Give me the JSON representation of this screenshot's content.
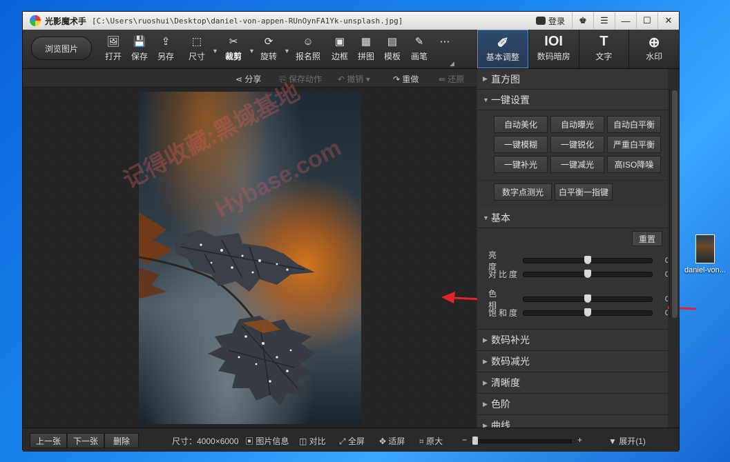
{
  "window": {
    "app_name": "光影魔术手",
    "file_path": "[C:\\Users\\ruoshui\\Desktop\\daniel-von-appen-RUnOynFA1Yk-unsplash.jpg]",
    "login": "登录",
    "min": "—",
    "max": "☐",
    "close": "✕"
  },
  "toolbar": {
    "browse": "浏览图片",
    "tools": [
      {
        "icon": "🖼",
        "label": "打开"
      },
      {
        "icon": "💾",
        "label": "保存"
      },
      {
        "icon": "⇪",
        "label": "另存"
      },
      {
        "icon": "⬚",
        "label": "尺寸"
      },
      {
        "icon": "✂",
        "label": "裁剪"
      },
      {
        "icon": "⟳",
        "label": "旋转"
      },
      {
        "icon": "☺",
        "label": "报名照"
      },
      {
        "icon": "▣",
        "label": "边框"
      },
      {
        "icon": "▦",
        "label": "拼图"
      },
      {
        "icon": "▤",
        "label": "模板"
      },
      {
        "icon": "✎",
        "label": "画笔"
      },
      {
        "icon": "⋯",
        "label": ""
      }
    ],
    "right_tabs": [
      {
        "icon": "✐",
        "label": "基本调整"
      },
      {
        "icon": "IOI",
        "label": "数码暗房"
      },
      {
        "icon": "T",
        "label": "文字"
      },
      {
        "icon": "⊕",
        "label": "水印"
      }
    ]
  },
  "subbar": {
    "share": "分享",
    "save_action": "保存动作",
    "undo": "撤销",
    "redo": "重做",
    "restore": "还原"
  },
  "watermark": {
    "line1": "记得收藏:黑域基地",
    "line2": "Hybase.com"
  },
  "panel": {
    "histogram": "直方图",
    "one_click": "一键设置",
    "presets": [
      "自动美化",
      "自动曝光",
      "自动白平衡",
      "一键模糊",
      "一键锐化",
      "严重白平衡",
      "一键补光",
      "一键减光",
      "高ISO降噪"
    ],
    "presets_row2": [
      "数字点测光",
      "白平衡一指键"
    ],
    "basic": "基本",
    "reset": "重置",
    "sliders": [
      {
        "name": "亮　度",
        "value": "0"
      },
      {
        "name": "对比度",
        "value": "0"
      },
      {
        "name": "色　相",
        "value": "0"
      },
      {
        "name": "饱和度",
        "value": "0"
      }
    ],
    "folds": [
      "数码补光",
      "数码减光",
      "清晰度",
      "色阶",
      "曲线"
    ]
  },
  "status": {
    "prev": "上一张",
    "next": "下一张",
    "delete": "删除",
    "size": "尺寸：4000×6000",
    "info": "图片信息",
    "compare": "对比",
    "fullscreen": "全屏",
    "fit": "适屏",
    "original": "原大",
    "minus": "−",
    "plus": "+",
    "expand": "展开(1)"
  },
  "desktop": {
    "icon_label": "daniel-von..."
  },
  "colors": {
    "arrow": "#e8202a",
    "accent_tab": "#5c8fc4"
  }
}
